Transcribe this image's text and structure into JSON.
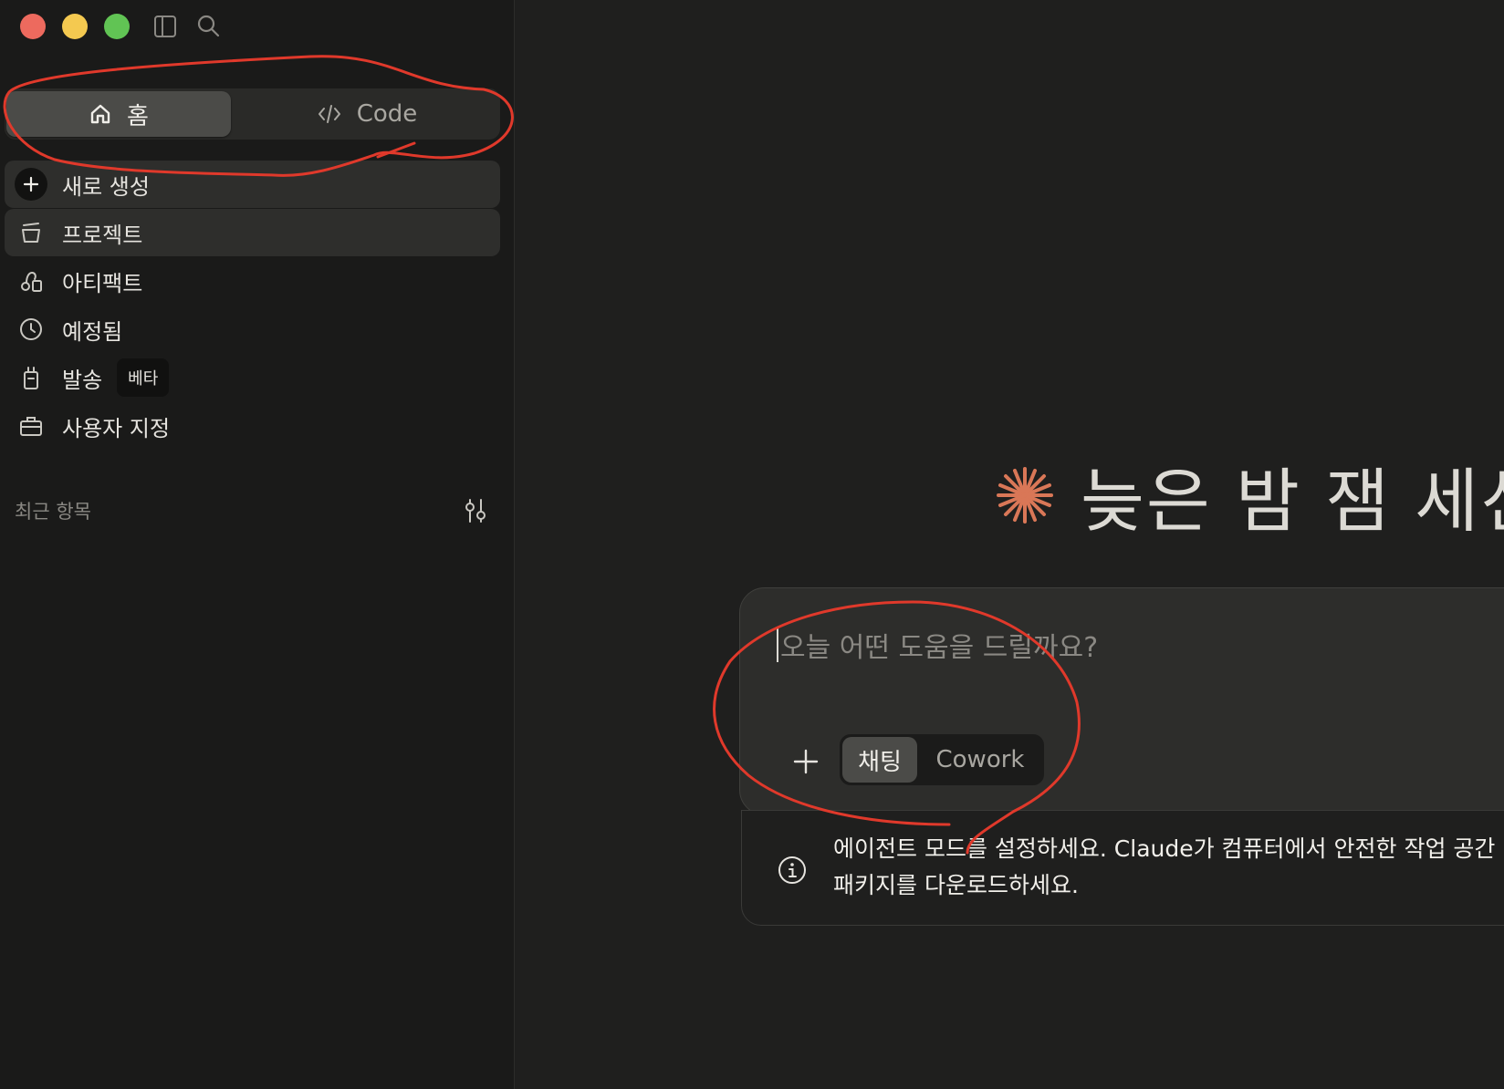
{
  "sidebar": {
    "mode_tabs": {
      "home_label": "홈",
      "code_label": "Code"
    },
    "nav": {
      "new_label": "새로 생성",
      "projects_label": "프로젝트",
      "artifacts_label": "아티팩트",
      "scheduled_label": "예정됨",
      "dispatch_label": "발송",
      "dispatch_badge": "베타",
      "customize_label": "사용자 지정"
    },
    "recents_label": "최근 항목"
  },
  "main": {
    "greeting": "늦은 밤 잼 세션",
    "composer": {
      "placeholder": "오늘 어떤 도움을 드릴까요?",
      "mode_chat_label": "채팅",
      "mode_cowork_label": "Cowork"
    },
    "notice": {
      "text": "에이전트 모드를 설정하세요. Claude가 컴퓨터에서 안전한 작업 공간\n패키지를 다운로드하세요."
    }
  },
  "colors": {
    "accent": "#d97757",
    "annotation": "#e0392b",
    "background": "#1f1f1e",
    "sidebar": "#1a1a19"
  },
  "icons": [
    "sidebar-toggle-icon",
    "search-icon",
    "home-icon",
    "code-icon",
    "plus-icon",
    "projects-icon",
    "artifacts-icon",
    "clock-icon",
    "dispatch-icon",
    "briefcase-icon",
    "filter-icon",
    "claude-spark-icon",
    "info-icon"
  ]
}
